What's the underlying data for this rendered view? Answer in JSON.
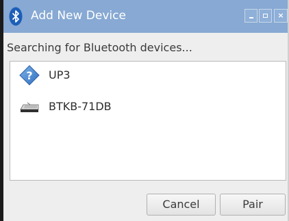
{
  "window": {
    "title": "Add New Device",
    "icon": "bluetooth-icon",
    "controls": [
      "minimize-icon",
      "maximize-icon",
      "close-icon"
    ],
    "close_glyph": "×"
  },
  "status_text": "Searching for Bluetooth devices...",
  "devices": [
    {
      "label": "UP3",
      "icon": "unknown-device-icon"
    },
    {
      "label": "BTKB-71DB",
      "icon": "keyboard-icon"
    }
  ],
  "buttons": {
    "cancel": "Cancel",
    "pair": "Pair"
  },
  "colors": {
    "titlebar": "#87a9d3",
    "window_bg": "#eeeeee",
    "list_bg": "#ffffff",
    "unknown_icon": "#3f7fc8"
  }
}
